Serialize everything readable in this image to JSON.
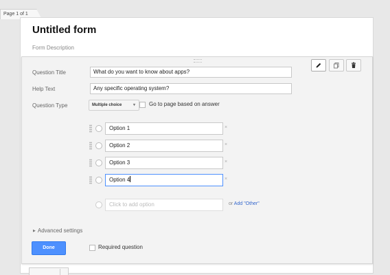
{
  "page_indicator": "Page 1 of 1",
  "form": {
    "title": "Untitled form",
    "description_placeholder": "Form Description"
  },
  "question": {
    "title_label": "Question Title",
    "title_value": "What do you want to know about apps?",
    "help_label": "Help Text",
    "help_value": "Any specific operating system?",
    "type_label": "Question Type",
    "type_value": "Multiple choice",
    "page_branch_label": "Go to page based on answer",
    "options": [
      {
        "label": "Option 1"
      },
      {
        "label": "Option 2"
      },
      {
        "label": "Option 3"
      },
      {
        "label": "Option 4"
      }
    ],
    "remove_glyph": "×",
    "add_option_placeholder": "Click to add option",
    "or_text": "or",
    "add_other_link": "Add \"Other\"",
    "advanced_settings": "Advanced settings",
    "done_button": "Done",
    "required_label": "Required question"
  },
  "toolbar_icons": [
    "pencil-icon",
    "duplicate-icon",
    "trash-icon"
  ],
  "colors": {
    "primary_button": "#4d90fe",
    "link": "#3366cc",
    "focus_border": "#4d90fe"
  }
}
